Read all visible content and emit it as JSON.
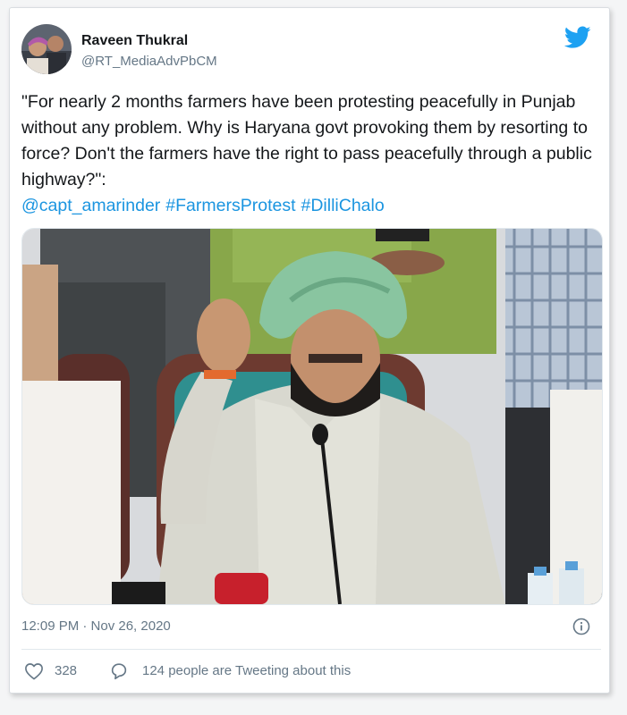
{
  "author": {
    "name": "Raveen Thukral",
    "handle": "@RT_MediaAdvPbCM",
    "avatar_icon": "profile-photo"
  },
  "brand": {
    "icon": "twitter-bird-icon",
    "color": "#1da1f2"
  },
  "tweet": {
    "text": "\"For nearly 2 months farmers have been protesting peacefully in Punjab without any problem. Why is Haryana govt provoking them by resorting to force? Don't the farmers have the right to pass peacefully through a public highway?\":",
    "mention": "@capt_amarinder",
    "hashtags": [
      "#FarmersProtest",
      "#DilliChalo"
    ],
    "link_color": "#1b95e0"
  },
  "media": {
    "alt_icon": "photo-press-conference"
  },
  "meta": {
    "timestamp": "12:09 PM · Nov 26, 2020",
    "info_icon": "info-icon"
  },
  "actions": {
    "like_count": "328",
    "reply_text": "124 people are Tweeting about this"
  }
}
